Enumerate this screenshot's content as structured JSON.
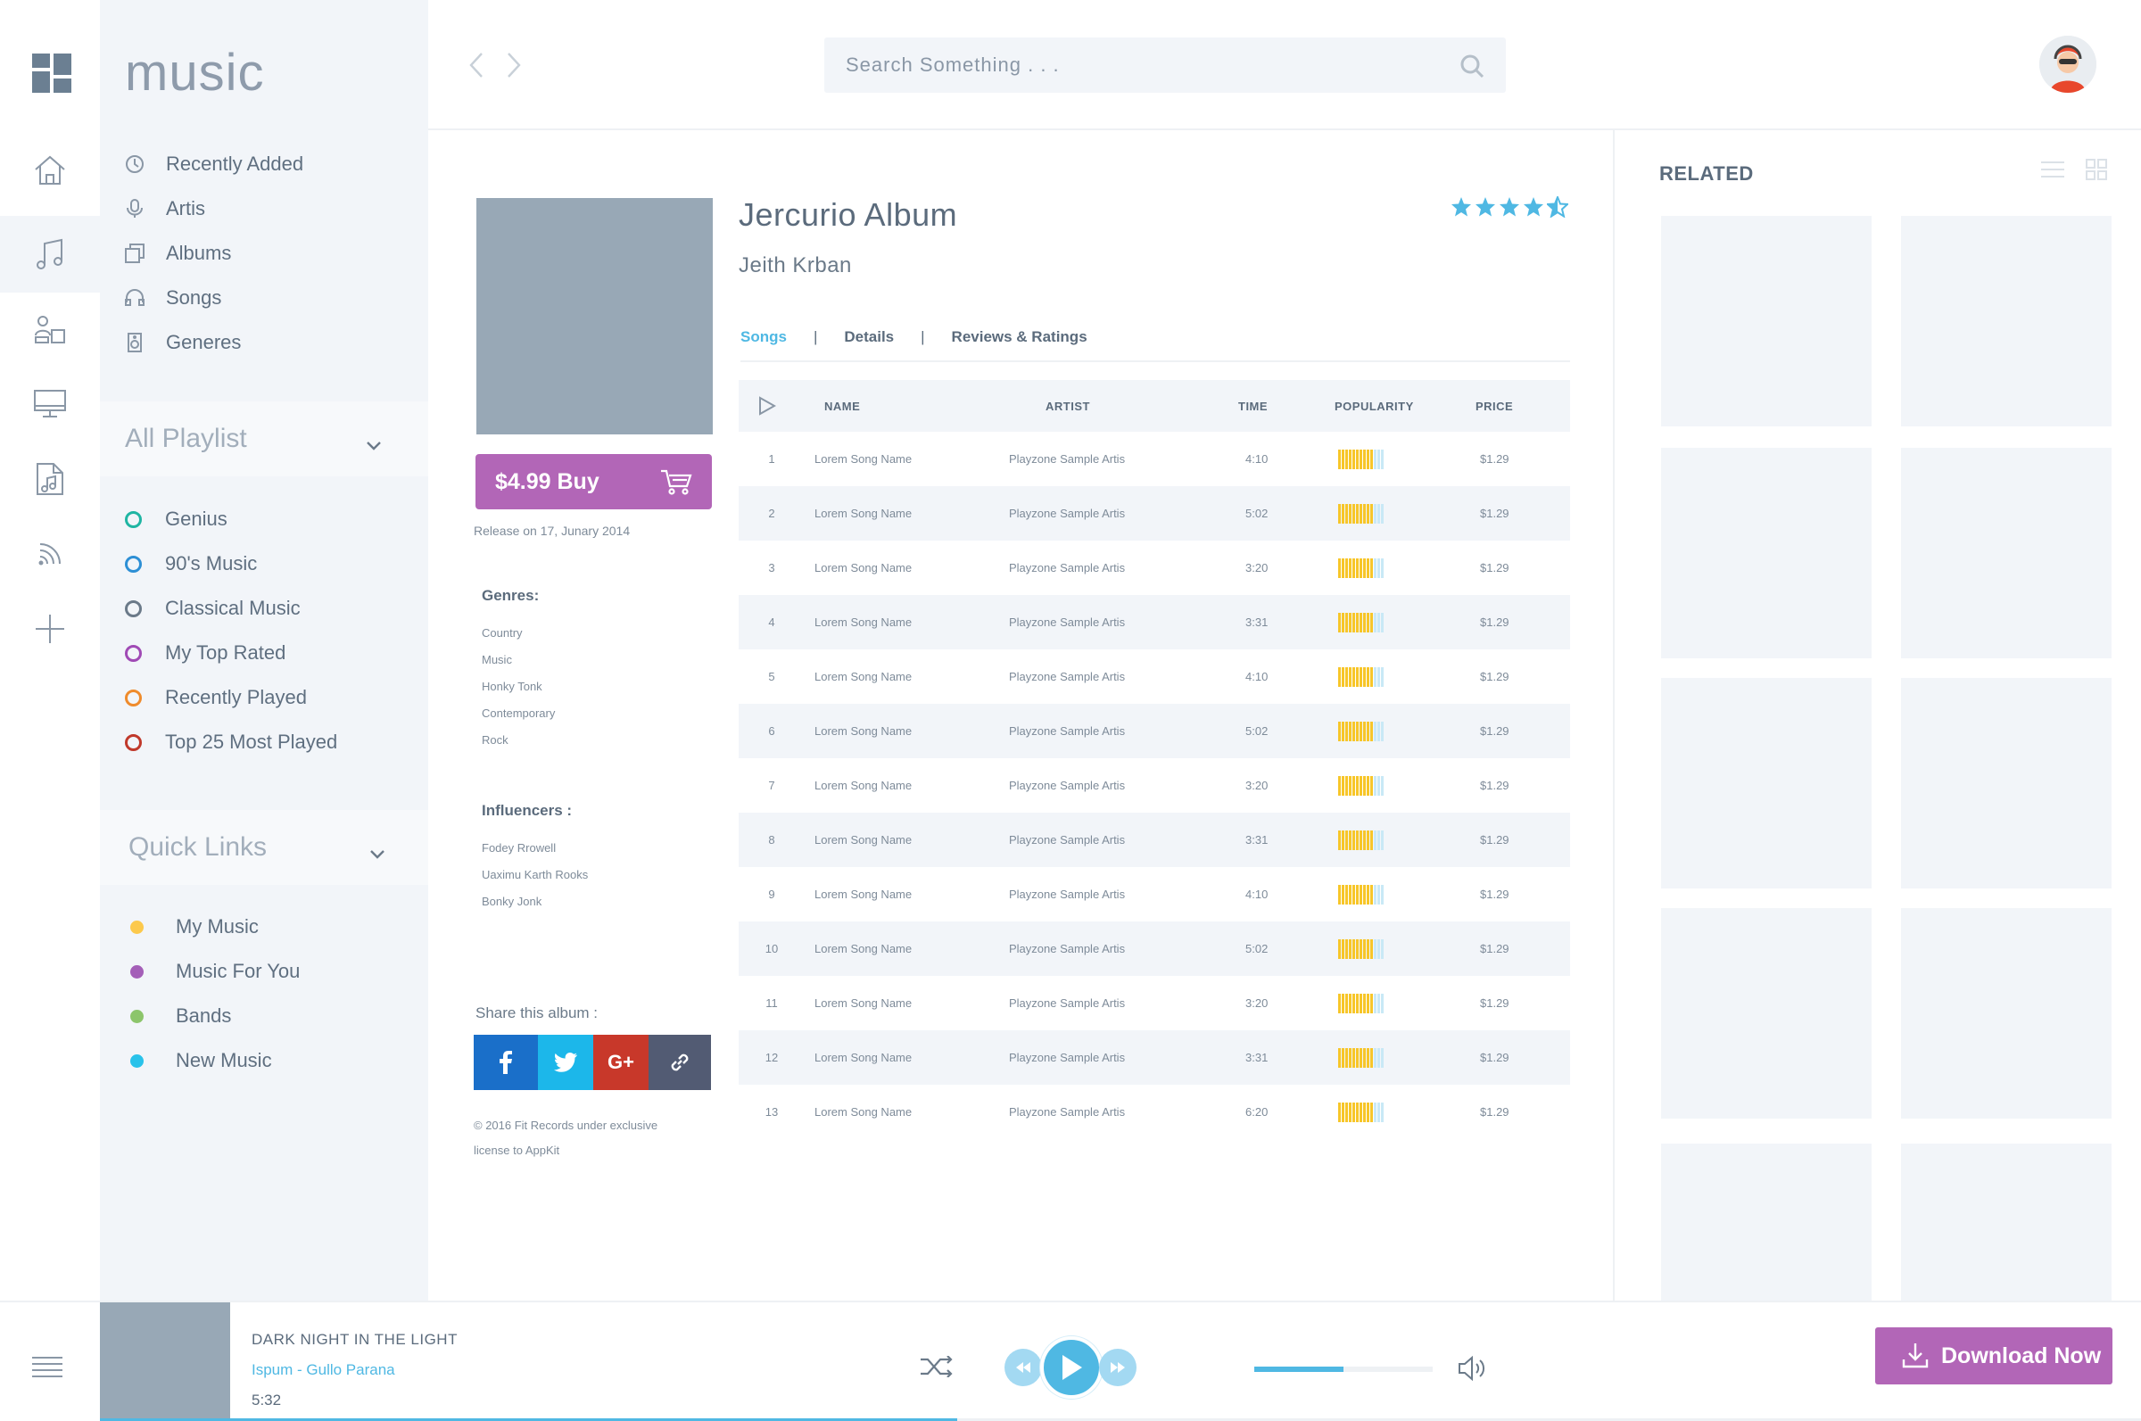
{
  "app": {
    "brand": "music"
  },
  "search": {
    "placeholder": "Search Something . . ."
  },
  "sidebar": {
    "menu": [
      {
        "label": "Recently Added",
        "icon": "clock-icon"
      },
      {
        "label": "Artis",
        "icon": "microphone-icon"
      },
      {
        "label": "Albums",
        "icon": "albums-icon"
      },
      {
        "label": "Songs",
        "icon": "headphones-icon"
      },
      {
        "label": "Generes",
        "icon": "speaker-icon"
      }
    ],
    "playlist_header": "All Playlist",
    "playlists": [
      {
        "label": "Genius",
        "color": "#1fb5a3"
      },
      {
        "label": "90's Music",
        "color": "#2d8fd5"
      },
      {
        "label": "Classical Music",
        "color": "#6b7a89"
      },
      {
        "label": "My Top Rated",
        "color": "#a04ab5"
      },
      {
        "label": "Recently Played",
        "color": "#ef8b2c"
      },
      {
        "label": "Top 25 Most Played",
        "color": "#c0392b"
      }
    ],
    "quicklinks_header": "Quick Links",
    "quicklinks": [
      {
        "label": "My Music",
        "color": "#fcc94c"
      },
      {
        "label": "Music For You",
        "color": "#a45fb8"
      },
      {
        "label": "Bands",
        "color": "#8cc56b"
      },
      {
        "label": "New Music",
        "color": "#29c2ea"
      }
    ]
  },
  "album": {
    "title": "Jercurio Album",
    "artist": "Jeith Krban",
    "rating": 4.5,
    "buy_label": "$4.99 Buy",
    "release": "Release on 17, Junary 2014",
    "genres_title": "Genres:",
    "genres": [
      "Country",
      "Music",
      "Honky Tonk",
      "Contemporary",
      "Rock"
    ],
    "influencers_title": "Influencers :",
    "influencers": [
      "Fodey Rrowell",
      "Uaximu Karth Rooks",
      "Bonky Jonk"
    ],
    "share_label": "Share this album :",
    "copyright_line1": "© 2016 Fit Records under exclusive",
    "copyright_line2": "license to AppKit"
  },
  "tabs": [
    "Songs",
    "Details",
    "Reviews & Ratings"
  ],
  "table": {
    "headers": {
      "name": "NAME",
      "artist": "ARTIST",
      "time": "TIME",
      "popularity": "POPULARITY",
      "price": "PRICE"
    },
    "rows": [
      {
        "n": "1",
        "name": "Lorem Song Name",
        "artist": "Playzone Sample Artis",
        "time": "4:10",
        "popularity": 0.75,
        "price": "$1.29"
      },
      {
        "n": "2",
        "name": "Lorem Song Name",
        "artist": "Playzone Sample Artis",
        "time": "5:02",
        "popularity": 0.75,
        "price": "$1.29"
      },
      {
        "n": "3",
        "name": "Lorem Song Name",
        "artist": "Playzone Sample Artis",
        "time": "3:20",
        "popularity": 0.75,
        "price": "$1.29"
      },
      {
        "n": "4",
        "name": "Lorem Song Name",
        "artist": "Playzone Sample Artis",
        "time": "3:31",
        "popularity": 0.75,
        "price": "$1.29"
      },
      {
        "n": "5",
        "name": "Lorem Song Name",
        "artist": "Playzone Sample Artis",
        "time": "4:10",
        "popularity": 0.75,
        "price": "$1.29"
      },
      {
        "n": "6",
        "name": "Lorem Song Name",
        "artist": "Playzone Sample Artis",
        "time": "5:02",
        "popularity": 0.75,
        "price": "$1.29"
      },
      {
        "n": "7",
        "name": "Lorem Song Name",
        "artist": "Playzone Sample Artis",
        "time": "3:20",
        "popularity": 0.75,
        "price": "$1.29"
      },
      {
        "n": "8",
        "name": "Lorem Song Name",
        "artist": "Playzone Sample Artis",
        "time": "3:31",
        "popularity": 0.75,
        "price": "$1.29"
      },
      {
        "n": "9",
        "name": "Lorem Song Name",
        "artist": "Playzone Sample Artis",
        "time": "4:10",
        "popularity": 0.75,
        "price": "$1.29"
      },
      {
        "n": "10",
        "name": "Lorem Song Name",
        "artist": "Playzone Sample Artis",
        "time": "5:02",
        "popularity": 0.75,
        "price": "$1.29"
      },
      {
        "n": "11",
        "name": "Lorem Song Name",
        "artist": "Playzone Sample Artis",
        "time": "3:20",
        "popularity": 0.75,
        "price": "$1.29"
      },
      {
        "n": "12",
        "name": "Lorem Song Name",
        "artist": "Playzone Sample Artis",
        "time": "3:31",
        "popularity": 0.75,
        "price": "$1.29"
      },
      {
        "n": "13",
        "name": "Lorem Song Name",
        "artist": "Playzone Sample Artis",
        "time": "6:20",
        "popularity": 0.75,
        "price": "$1.29"
      }
    ]
  },
  "related": {
    "title": "RELATED"
  },
  "player": {
    "title": "DARK NIGHT IN THE LIGHT",
    "artist": "Ispum - Gullo Parana",
    "time": "5:32",
    "track_progress": 0.42,
    "volume": 0.5,
    "download_label": "Download Now"
  },
  "colors": {
    "accent_purple": "#b266b7",
    "accent_blue": "#4fb8e3",
    "star": "#4fb8e3",
    "bar_filled": "#f7c629",
    "bar_empty": "#c9e9f6"
  }
}
